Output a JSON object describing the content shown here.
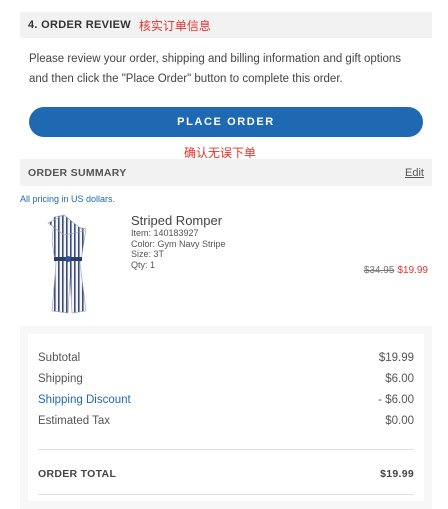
{
  "review": {
    "title": "4. ORDER REVIEW",
    "annotation": "核实订单信息",
    "instructions": "Please review your order, shipping and billing information and gift options and then click the \"Place Order\" button to complete this order."
  },
  "place_order": {
    "label": "PLACE ORDER",
    "annotation": "确认无误下单",
    "color": "#1f69b2"
  },
  "summary": {
    "title": "ORDER SUMMARY",
    "edit_label": "Edit",
    "pricing_note": "All pricing in US dollars."
  },
  "product": {
    "name": "Striped Romper",
    "item": "Item: 140183927",
    "color": "Color: Gym Navy Stripe",
    "size": "Size: 3T",
    "qty": "Qty: 1",
    "old_price": "$34.95",
    "new_price": "$19.99"
  },
  "totals": {
    "rows": [
      {
        "label": "Subtotal",
        "value": "$19.99"
      },
      {
        "label": "Shipping",
        "value": "$6.00"
      },
      {
        "label": "Shipping Discount",
        "value": "- $6.00"
      },
      {
        "label": "Estimated Tax",
        "value": "$0.00"
      }
    ],
    "order_total_label": "ORDER TOTAL",
    "order_total_value": "$19.99"
  },
  "colors": {
    "accent_blue": "#1f69b2",
    "sale_red": "#e8322b",
    "panel_gray": "#f2f2f2"
  }
}
